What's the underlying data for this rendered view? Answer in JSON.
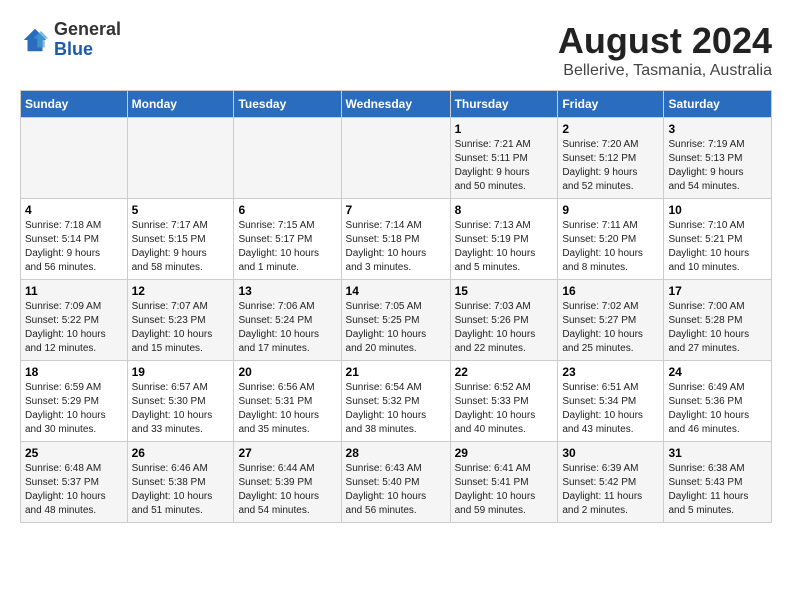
{
  "header": {
    "logo_line1": "General",
    "logo_line2": "Blue",
    "main_title": "August 2024",
    "sub_title": "Bellerive, Tasmania, Australia"
  },
  "days_of_week": [
    "Sunday",
    "Monday",
    "Tuesday",
    "Wednesday",
    "Thursday",
    "Friday",
    "Saturday"
  ],
  "weeks": [
    [
      {
        "num": "",
        "info": ""
      },
      {
        "num": "",
        "info": ""
      },
      {
        "num": "",
        "info": ""
      },
      {
        "num": "",
        "info": ""
      },
      {
        "num": "1",
        "info": "Sunrise: 7:21 AM\nSunset: 5:11 PM\nDaylight: 9 hours\nand 50 minutes."
      },
      {
        "num": "2",
        "info": "Sunrise: 7:20 AM\nSunset: 5:12 PM\nDaylight: 9 hours\nand 52 minutes."
      },
      {
        "num": "3",
        "info": "Sunrise: 7:19 AM\nSunset: 5:13 PM\nDaylight: 9 hours\nand 54 minutes."
      }
    ],
    [
      {
        "num": "4",
        "info": "Sunrise: 7:18 AM\nSunset: 5:14 PM\nDaylight: 9 hours\nand 56 minutes."
      },
      {
        "num": "5",
        "info": "Sunrise: 7:17 AM\nSunset: 5:15 PM\nDaylight: 9 hours\nand 58 minutes."
      },
      {
        "num": "6",
        "info": "Sunrise: 7:15 AM\nSunset: 5:17 PM\nDaylight: 10 hours\nand 1 minute."
      },
      {
        "num": "7",
        "info": "Sunrise: 7:14 AM\nSunset: 5:18 PM\nDaylight: 10 hours\nand 3 minutes."
      },
      {
        "num": "8",
        "info": "Sunrise: 7:13 AM\nSunset: 5:19 PM\nDaylight: 10 hours\nand 5 minutes."
      },
      {
        "num": "9",
        "info": "Sunrise: 7:11 AM\nSunset: 5:20 PM\nDaylight: 10 hours\nand 8 minutes."
      },
      {
        "num": "10",
        "info": "Sunrise: 7:10 AM\nSunset: 5:21 PM\nDaylight: 10 hours\nand 10 minutes."
      }
    ],
    [
      {
        "num": "11",
        "info": "Sunrise: 7:09 AM\nSunset: 5:22 PM\nDaylight: 10 hours\nand 12 minutes."
      },
      {
        "num": "12",
        "info": "Sunrise: 7:07 AM\nSunset: 5:23 PM\nDaylight: 10 hours\nand 15 minutes."
      },
      {
        "num": "13",
        "info": "Sunrise: 7:06 AM\nSunset: 5:24 PM\nDaylight: 10 hours\nand 17 minutes."
      },
      {
        "num": "14",
        "info": "Sunrise: 7:05 AM\nSunset: 5:25 PM\nDaylight: 10 hours\nand 20 minutes."
      },
      {
        "num": "15",
        "info": "Sunrise: 7:03 AM\nSunset: 5:26 PM\nDaylight: 10 hours\nand 22 minutes."
      },
      {
        "num": "16",
        "info": "Sunrise: 7:02 AM\nSunset: 5:27 PM\nDaylight: 10 hours\nand 25 minutes."
      },
      {
        "num": "17",
        "info": "Sunrise: 7:00 AM\nSunset: 5:28 PM\nDaylight: 10 hours\nand 27 minutes."
      }
    ],
    [
      {
        "num": "18",
        "info": "Sunrise: 6:59 AM\nSunset: 5:29 PM\nDaylight: 10 hours\nand 30 minutes."
      },
      {
        "num": "19",
        "info": "Sunrise: 6:57 AM\nSunset: 5:30 PM\nDaylight: 10 hours\nand 33 minutes."
      },
      {
        "num": "20",
        "info": "Sunrise: 6:56 AM\nSunset: 5:31 PM\nDaylight: 10 hours\nand 35 minutes."
      },
      {
        "num": "21",
        "info": "Sunrise: 6:54 AM\nSunset: 5:32 PM\nDaylight: 10 hours\nand 38 minutes."
      },
      {
        "num": "22",
        "info": "Sunrise: 6:52 AM\nSunset: 5:33 PM\nDaylight: 10 hours\nand 40 minutes."
      },
      {
        "num": "23",
        "info": "Sunrise: 6:51 AM\nSunset: 5:34 PM\nDaylight: 10 hours\nand 43 minutes."
      },
      {
        "num": "24",
        "info": "Sunrise: 6:49 AM\nSunset: 5:36 PM\nDaylight: 10 hours\nand 46 minutes."
      }
    ],
    [
      {
        "num": "25",
        "info": "Sunrise: 6:48 AM\nSunset: 5:37 PM\nDaylight: 10 hours\nand 48 minutes."
      },
      {
        "num": "26",
        "info": "Sunrise: 6:46 AM\nSunset: 5:38 PM\nDaylight: 10 hours\nand 51 minutes."
      },
      {
        "num": "27",
        "info": "Sunrise: 6:44 AM\nSunset: 5:39 PM\nDaylight: 10 hours\nand 54 minutes."
      },
      {
        "num": "28",
        "info": "Sunrise: 6:43 AM\nSunset: 5:40 PM\nDaylight: 10 hours\nand 56 minutes."
      },
      {
        "num": "29",
        "info": "Sunrise: 6:41 AM\nSunset: 5:41 PM\nDaylight: 10 hours\nand 59 minutes."
      },
      {
        "num": "30",
        "info": "Sunrise: 6:39 AM\nSunset: 5:42 PM\nDaylight: 11 hours\nand 2 minutes."
      },
      {
        "num": "31",
        "info": "Sunrise: 6:38 AM\nSunset: 5:43 PM\nDaylight: 11 hours\nand 5 minutes."
      }
    ]
  ]
}
